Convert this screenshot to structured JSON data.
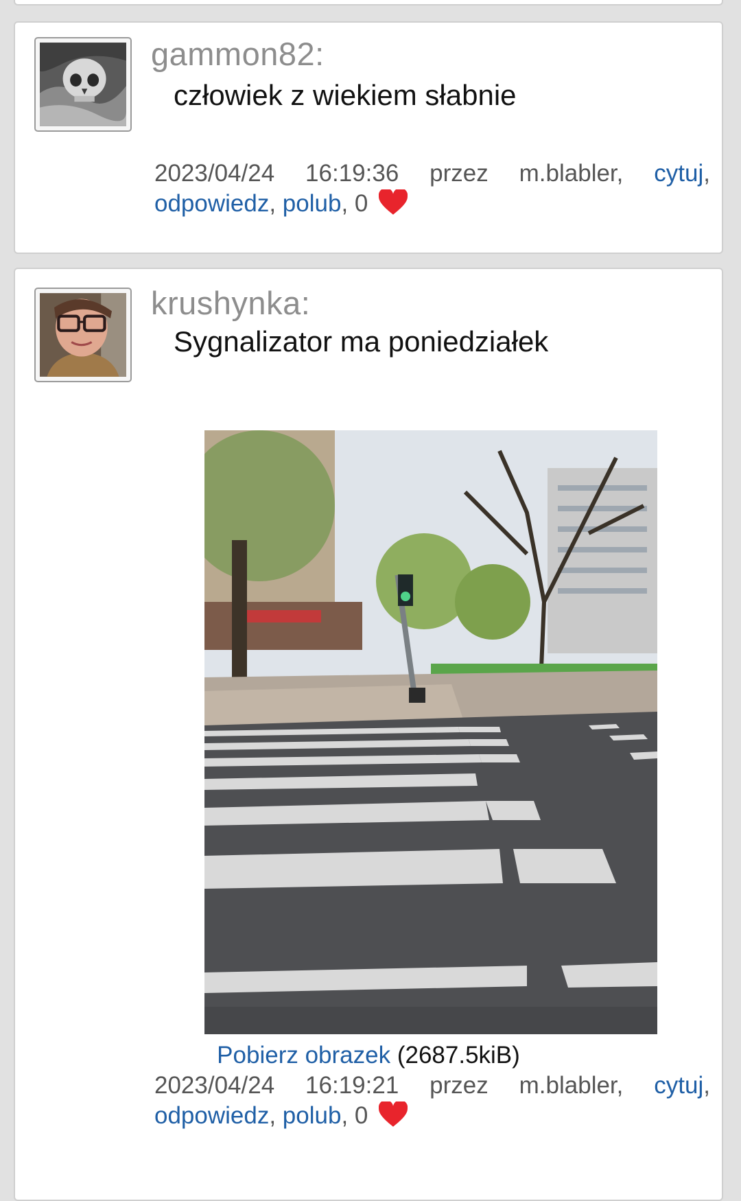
{
  "posts": [
    {
      "username": "gammon82:",
      "message": "człowiek z wiekiem słabnie",
      "date": "2023/04/24",
      "time": "16:19:36",
      "by_label": "przez",
      "author": "m.blabler,",
      "quote_label": "cytuj",
      "reply_label": "odpowiedz",
      "like_label": "polub",
      "like_count": "0",
      "avatar_icon": "skull-avatar"
    },
    {
      "username": "krushynka:",
      "message": "Sygnalizator ma poniedziałek",
      "date": "2023/04/24",
      "time": "16:19:21",
      "by_label": "przez",
      "author": "m.blabler,",
      "quote_label": "cytuj",
      "reply_label": "odpowiedz",
      "like_label": "polub",
      "like_count": "0",
      "avatar_icon": "woman-glasses-avatar",
      "attachment": {
        "download_label": "Pobierz obrazek",
        "size": "(2687.5kiB)"
      }
    }
  ],
  "colors": {
    "background": "#e1e1e1",
    "link": "#1f5fa6",
    "heart": "#e8242c",
    "username": "#8d8d8d"
  },
  "icons": {
    "like": "heart-icon"
  }
}
